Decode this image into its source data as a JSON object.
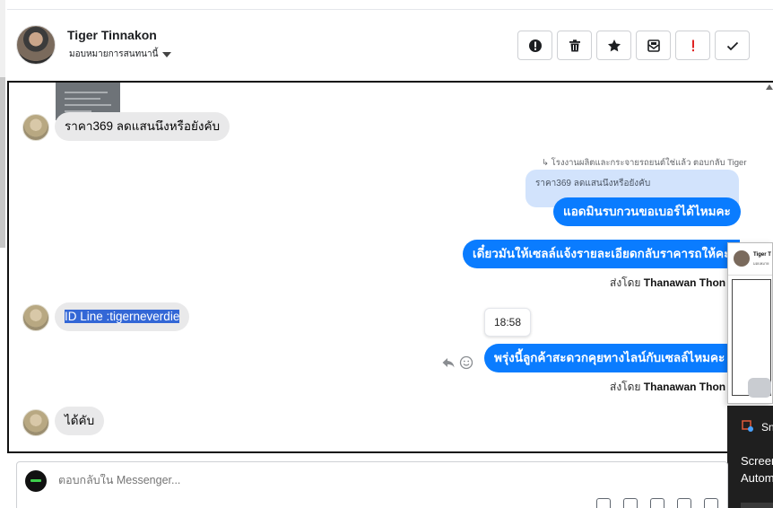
{
  "header": {
    "contact_name": "Tiger Tinnakon",
    "assign_label": "มอบหมายการสนทนานี้",
    "actions": [
      {
        "icon": "alert-circle-icon",
        "name": "spam-button"
      },
      {
        "icon": "trash-icon",
        "name": "delete-button"
      },
      {
        "icon": "star-icon",
        "name": "star-button"
      },
      {
        "icon": "mark-unread-icon",
        "name": "mark-unread-button"
      },
      {
        "icon": "exclamation-icon",
        "name": "follow-up-button"
      },
      {
        "icon": "check-icon",
        "name": "done-button"
      }
    ]
  },
  "thread": {
    "msg1": "ราคา369 ลดแสนนึงหรือยังคับ",
    "reply_meta": "โรงงานผลิตและกระจายรถยนต์ใช่แล้ว ตอบกลับ Tiger",
    "quoted_text": "ราคา369 ลดแสนนึงหรือยังคับ",
    "msg2": "แอดมินรบกวนขอเบอร์ได้ไหมคะ",
    "msg3": "เดี๋ยวมันให้เซลล์แจ้งรายละเอียดกลับราคารถให้คะ",
    "sent_by_label": "ส่งโดย",
    "sent_by_name": "Thanawan Thon",
    "msg4": "ID Line :tigerneverdie",
    "timestamp": "18:58",
    "msg5": "พรุ่งนี้ลูกค้าสะดวกคุยทางไลน์กับเซลล์ไหมคะ",
    "msg6": "ได้คับ"
  },
  "preview": {
    "name": "Tiger T",
    "sub": "มอบหมาย"
  },
  "toast": {
    "app": "Sn",
    "title_line1": "Screen",
    "title_line2": "Autom"
  },
  "composer": {
    "placeholder": "ตอบกลับใน Messenger..."
  },
  "colors": {
    "outgoing_bubble": "#0a7cff",
    "incoming_bubble": "#e9e9ea",
    "quoted_bg": "#d2e3fc",
    "selection": "#3367d6",
    "follow_up_red": "#e02424"
  }
}
